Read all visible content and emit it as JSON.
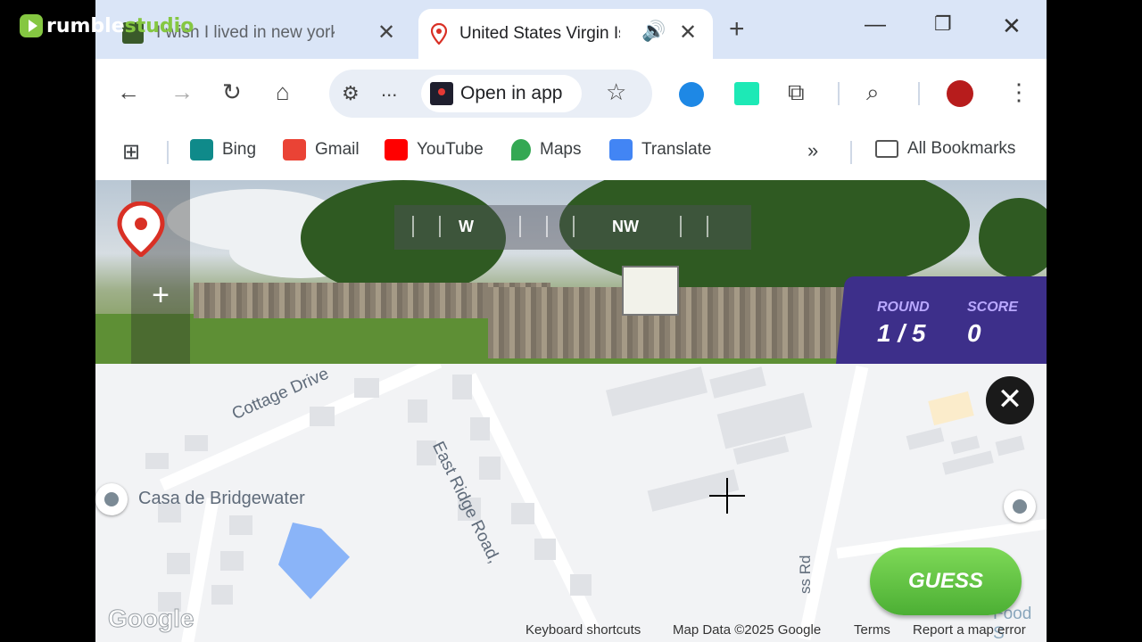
{
  "watermark": {
    "brand_a": "rumble",
    "brand_b": "studio"
  },
  "tabs": [
    {
      "title": "I wish I lived in new york"
    },
    {
      "title": "United States Virgin Is"
    }
  ],
  "toolbar": {
    "ellipsis": "...",
    "open_in_app": "Open in app"
  },
  "bookmarks": {
    "items": [
      {
        "label": "Bing",
        "color": "#0f8a8a"
      },
      {
        "label": "Gmail",
        "color": "#ea4335"
      },
      {
        "label": "YouTube",
        "color": "#ff0000"
      },
      {
        "label": "Maps",
        "color": "#34a853"
      },
      {
        "label": "Translate",
        "color": "#4285f4"
      }
    ],
    "all_bookmarks": "All Bookmarks"
  },
  "streetview": {
    "compass": {
      "w": "W",
      "nw": "NW"
    },
    "round_label": "ROUND",
    "round_value": "1 / 5",
    "score_label": "SCORE",
    "score_value": "0",
    "panel_color": "#3d2f8a"
  },
  "map": {
    "labels": {
      "cottage": "Cottage Drive",
      "casa": "Casa de Bridgewater",
      "east_ridge": "East Ridge Road,",
      "ss_rd": "ss Rd",
      "food": "at Food S"
    },
    "guess_label": "GUESS",
    "google_logo": "Google",
    "attribution": {
      "keyboard": "Keyboard shortcuts",
      "mapdata": "Map Data ©2025 Google",
      "terms": "Terms",
      "report": "Report a map error"
    }
  }
}
